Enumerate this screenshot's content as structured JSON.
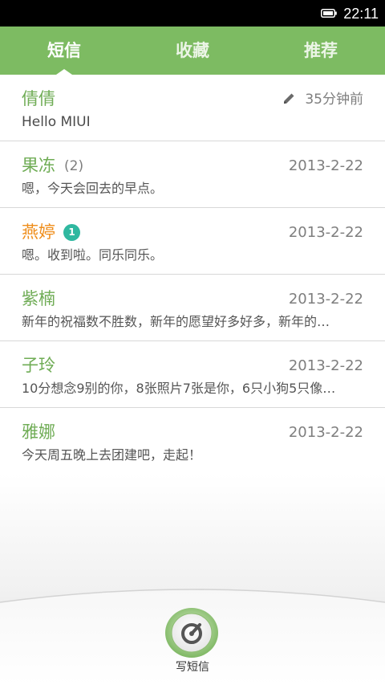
{
  "status_bar": {
    "time": "22:11",
    "battery_icon": "battery-full-icon"
  },
  "tabs": [
    {
      "label": "短信",
      "active": true
    },
    {
      "label": "收藏",
      "active": false
    },
    {
      "label": "推荐",
      "active": false
    }
  ],
  "conversations": [
    {
      "name": "倩倩",
      "date": "35分钟前",
      "preview": "Hello MIUI",
      "draft_icon": "pencil-icon"
    },
    {
      "name": "果冻",
      "count": "(2)",
      "date": "2013-2-22",
      "preview": "嗯，今天会回去的早点。"
    },
    {
      "name": "燕婷",
      "unread_badge": "1",
      "date": "2013-2-22",
      "preview": "嗯。收到啦。同乐同乐。"
    },
    {
      "name": "紫楠",
      "date": "2013-2-22",
      "preview": "新年的祝福数不胜数，新年的愿望好多好多，新年的…"
    },
    {
      "name": "子玲",
      "date": "2013-2-22",
      "preview": "10分想念9别的你，8张照片7张是你，6只小狗5只像…"
    },
    {
      "name": "雅娜",
      "date": "2013-2-22",
      "preview": "今天周五晚上去团建吧，走起！"
    }
  ],
  "compose": {
    "label": "写短信",
    "icon": "compose-icon"
  },
  "colors": {
    "tab_bar": "#7dbb62",
    "contact_name": "#6fac55",
    "unread_name": "#ef8d1a",
    "badge": "#2fb8a0"
  }
}
